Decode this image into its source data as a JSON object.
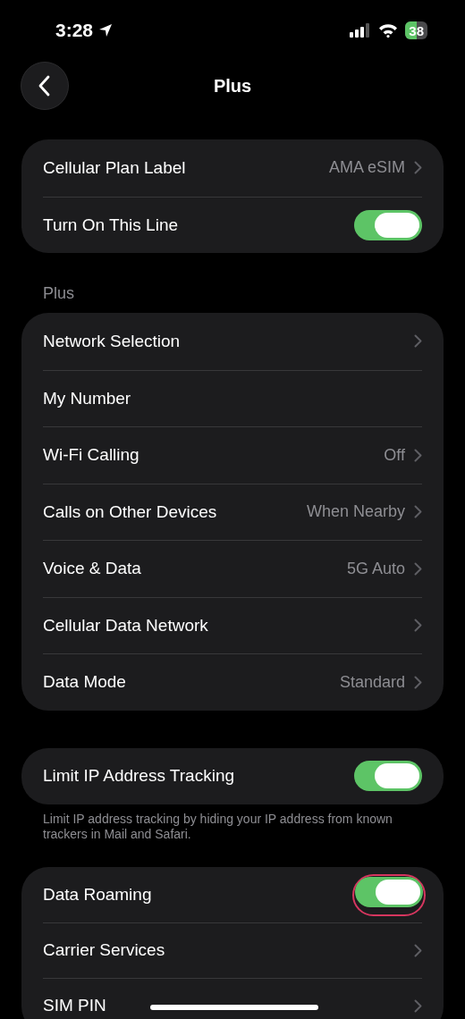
{
  "status_bar": {
    "time": "3:28",
    "battery": "38"
  },
  "nav": {
    "title": "Plus"
  },
  "groups": [
    {
      "rows": [
        {
          "kind": "link",
          "label": "Cellular Plan Label",
          "value": "AMA eSIM"
        },
        {
          "kind": "toggle",
          "label": "Turn On This Line",
          "on": true,
          "highlighted": false
        }
      ]
    },
    {
      "header": "Plus",
      "rows": [
        {
          "kind": "link",
          "label": "Network Selection"
        },
        {
          "kind": "plain",
          "label": "My Number"
        },
        {
          "kind": "link",
          "label": "Wi-Fi Calling",
          "value": "Off"
        },
        {
          "kind": "link",
          "label": "Calls on Other Devices",
          "value": "When Nearby"
        },
        {
          "kind": "link",
          "label": "Voice & Data",
          "value": "5G Auto"
        },
        {
          "kind": "link",
          "label": "Cellular Data Network"
        },
        {
          "kind": "link",
          "label": "Data Mode",
          "value": "Standard"
        }
      ]
    },
    {
      "rows": [
        {
          "kind": "toggle",
          "label": "Limit IP Address Tracking",
          "on": true,
          "highlighted": false
        }
      ],
      "footer": "Limit IP address tracking by hiding your IP address from known trackers in Mail and Safari."
    },
    {
      "rows": [
        {
          "kind": "toggle",
          "label": "Data Roaming",
          "on": true,
          "highlighted": true
        },
        {
          "kind": "link",
          "label": "Carrier Services"
        },
        {
          "kind": "link",
          "label": "SIM PIN"
        }
      ]
    }
  ]
}
